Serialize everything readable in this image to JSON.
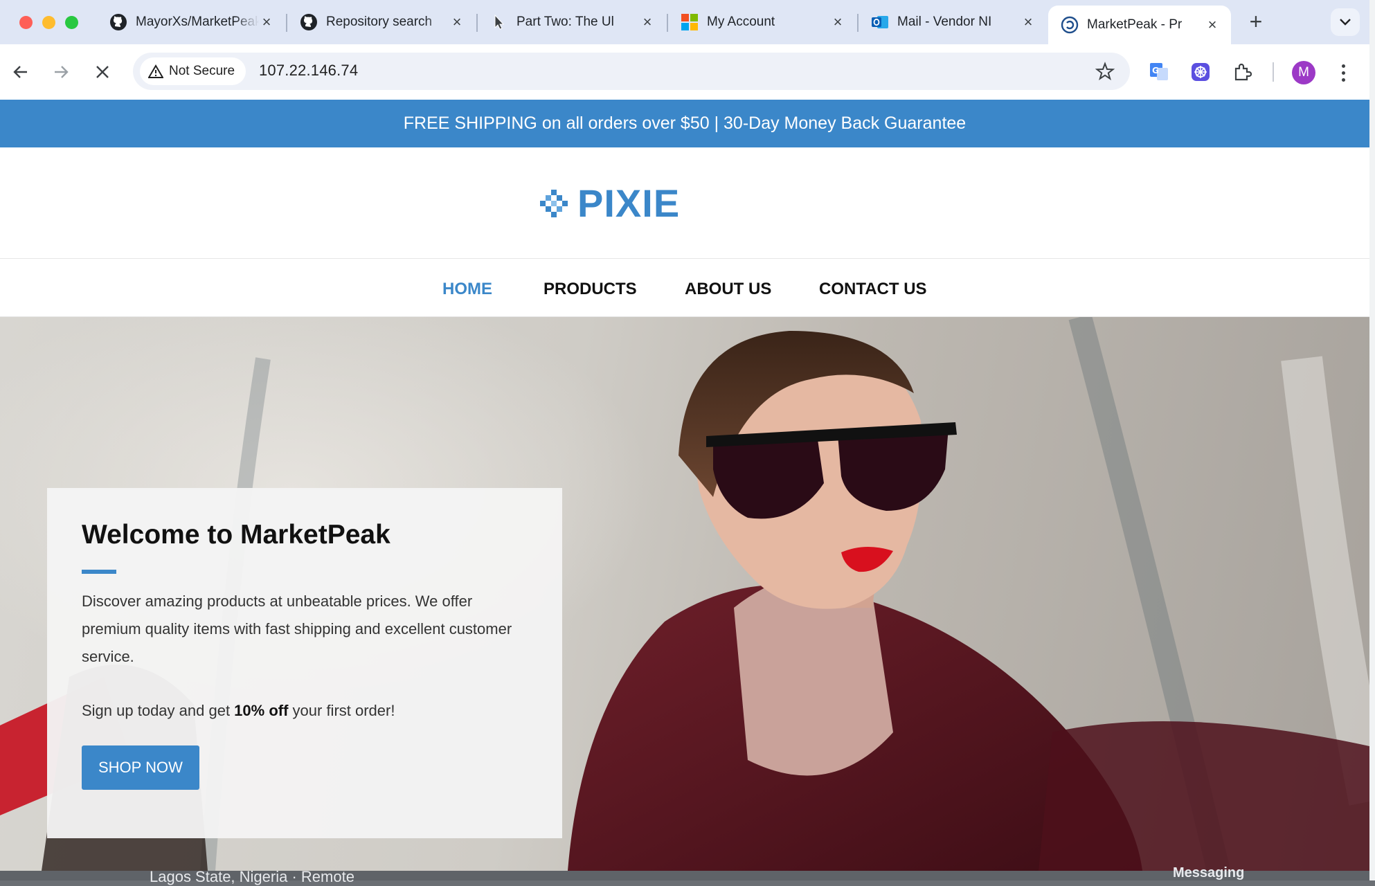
{
  "browser": {
    "tabs": [
      {
        "title": "MayorXs/MarketPeak",
        "favicon": "github-icon",
        "active": false
      },
      {
        "title": "Repository search",
        "favicon": "github-icon",
        "active": false
      },
      {
        "title": "Part Two: The Ul",
        "favicon": "cursor-icon",
        "active": false
      },
      {
        "title": "My Account",
        "favicon": "microsoft-icon",
        "active": false
      },
      {
        "title": "Mail - Vendor NI",
        "favicon": "outlook-icon",
        "active": false
      },
      {
        "title": "MarketPeak - Pr",
        "favicon": "globe-icon",
        "active": true
      }
    ],
    "security_label": "Not Secure",
    "url": "107.22.146.74",
    "profile_initial": "M"
  },
  "page": {
    "promo_banner": "FREE SHIPPING on all orders over $50 | 30-Day Money Back Guarantee",
    "logo_text": "PIXIE",
    "nav": [
      {
        "label": "HOME",
        "active": true
      },
      {
        "label": "PRODUCTS",
        "active": false
      },
      {
        "label": "ABOUT US",
        "active": false
      },
      {
        "label": "CONTACT US",
        "active": false
      }
    ],
    "hero": {
      "title": "Welcome to MarketPeak",
      "description": "Discover amazing products at unbeatable prices. We offer premium quality items with fast shipping and excellent customer service.",
      "signup_prefix": "Sign up today and get ",
      "signup_bold": "10% off",
      "signup_suffix": " your first order!",
      "cta_label": "SHOP NOW"
    }
  },
  "background_window": {
    "text_left": "Lagos State, Nigeria · Remote",
    "text_right": "Messaging"
  },
  "colors": {
    "accent": "#3b87c9",
    "tabstrip": "#dfe6f5",
    "profile": "#9c39c6"
  }
}
